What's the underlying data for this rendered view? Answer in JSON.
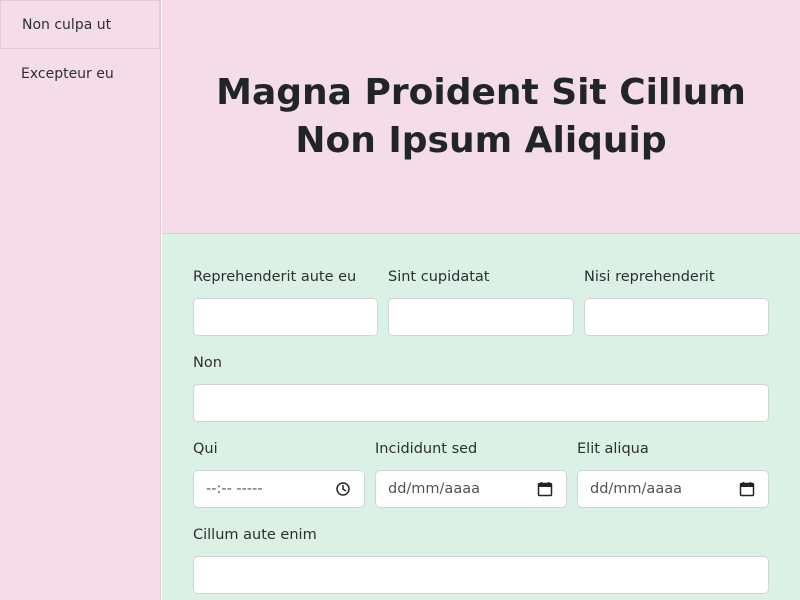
{
  "sidebar": {
    "items": [
      {
        "label": "Non culpa ut"
      },
      {
        "label": "Excepteur eu"
      }
    ]
  },
  "header": {
    "title": "Magna Proident Sit Cillum Non Ipsum Aliquip"
  },
  "form": {
    "fields": [
      {
        "label": "Reprehenderit aute eu",
        "type": "text",
        "value": ""
      },
      {
        "label": "Sint cupidatat",
        "type": "text",
        "value": ""
      },
      {
        "label": "Nisi reprehenderit",
        "type": "text",
        "value": ""
      },
      {
        "label": "Non",
        "type": "text",
        "value": ""
      },
      {
        "label": "Qui",
        "type": "time",
        "placeholder": "--:-- -----",
        "icon": "clock-icon"
      },
      {
        "label": "Incididunt sed",
        "type": "date",
        "placeholder": "dd/mm/aaaa",
        "icon": "calendar-icon"
      },
      {
        "label": "Elit aliqua",
        "type": "date",
        "placeholder": "dd/mm/aaaa",
        "icon": "calendar-icon"
      },
      {
        "label": "Cillum aute enim",
        "type": "text",
        "value": ""
      }
    ]
  }
}
